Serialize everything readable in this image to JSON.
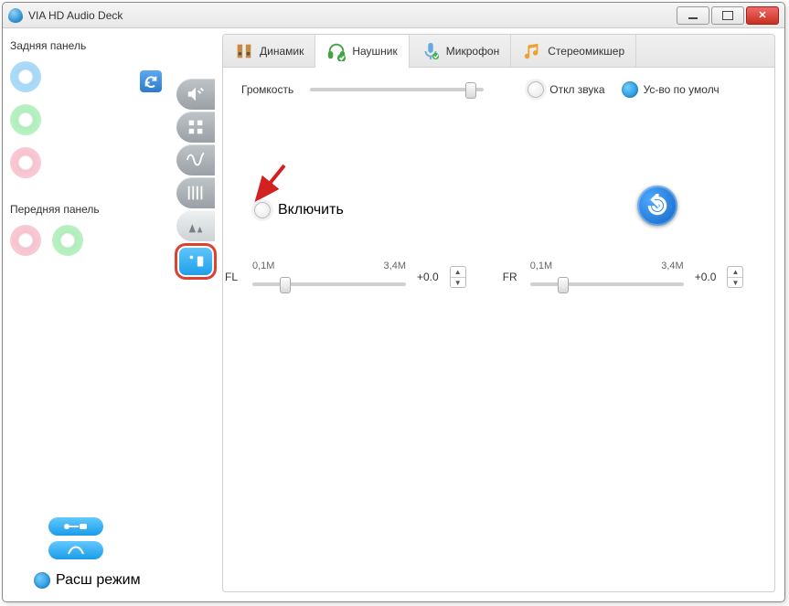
{
  "window": {
    "title": "VIA HD Audio Deck"
  },
  "sidebar": {
    "back_panel_label": "Задняя панель",
    "front_panel_label": "Передняя панель",
    "mode_label": "Расш режим"
  },
  "tabs": [
    {
      "label": "Динамик"
    },
    {
      "label": "Наушник"
    },
    {
      "label": "Микрофон"
    },
    {
      "label": "Стереомикшер"
    }
  ],
  "volume": {
    "label": "Громкость",
    "mute_label": "Откл звука",
    "default_label": "Ус-во по умолч"
  },
  "enable_label": "Включить",
  "channels": {
    "fl": {
      "label": "FL",
      "scale_min": "0,1M",
      "scale_max": "3,4M",
      "value": "+0.0"
    },
    "fr": {
      "label": "FR",
      "scale_min": "0,1M",
      "scale_max": "3,4M",
      "value": "+0.0"
    }
  }
}
